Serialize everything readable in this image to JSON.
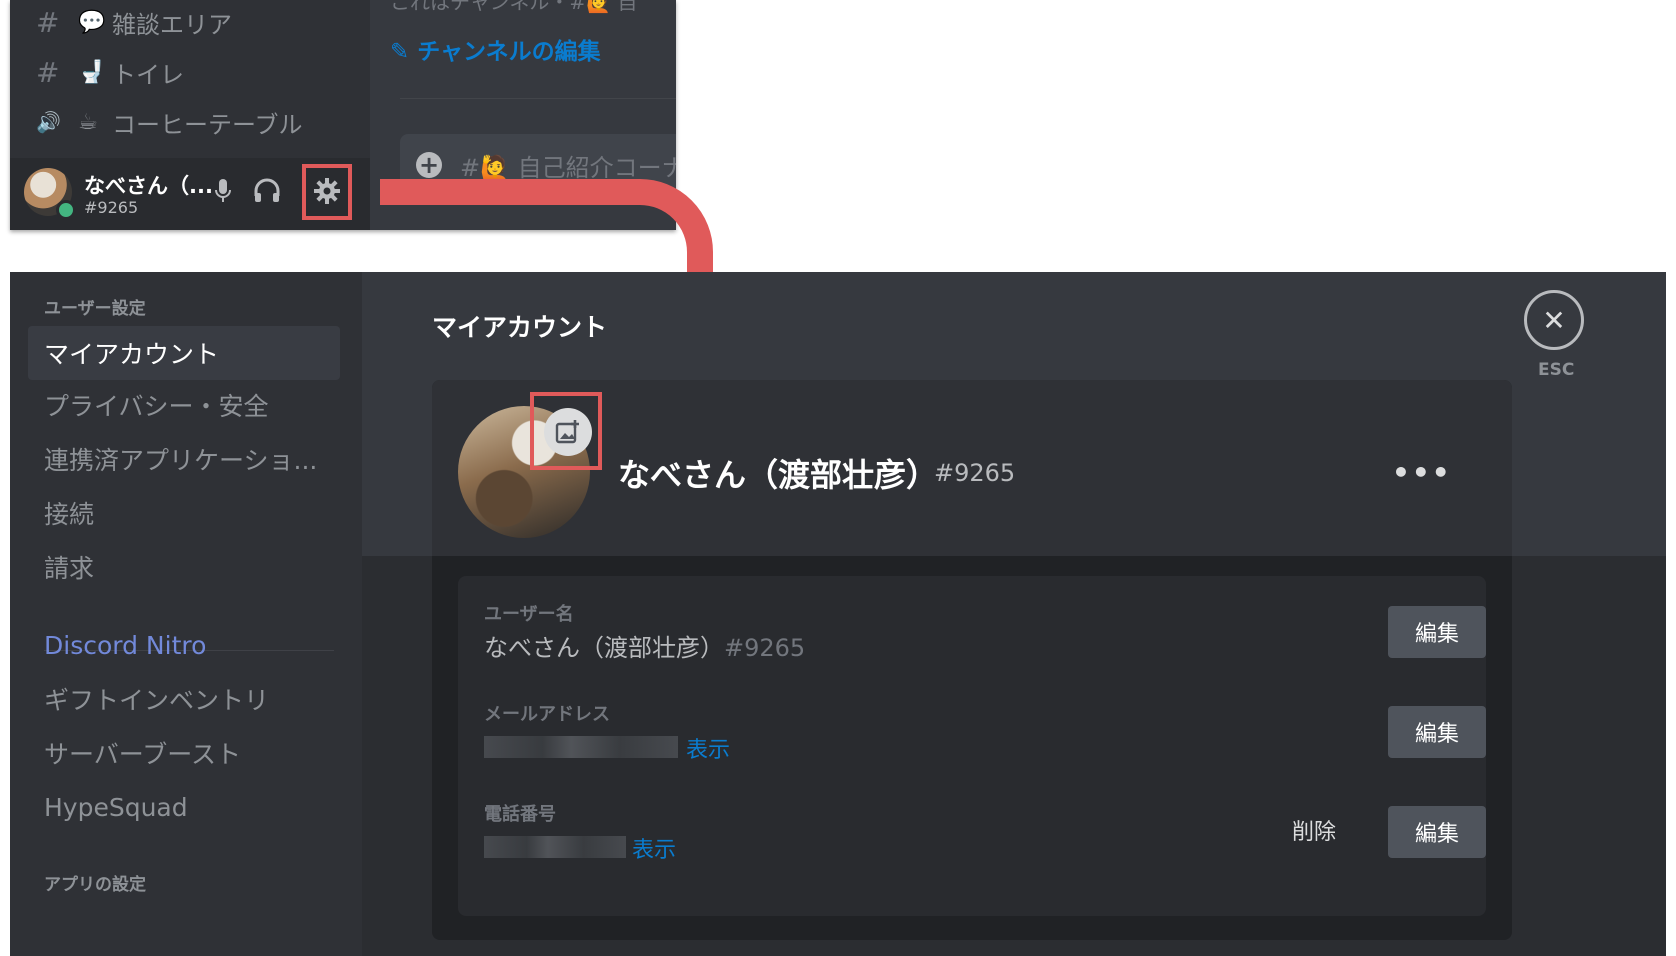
{
  "top_panel": {
    "channels": [
      {
        "prefix": "#",
        "emoji": "💬",
        "name": "雑談エリア"
      },
      {
        "prefix": "#",
        "emoji": "🚽",
        "name": "トイレ"
      },
      {
        "prefix": "🔊",
        "emoji": "☕",
        "name": "コーヒーテーブル"
      }
    ],
    "chat": {
      "top_text": "これはチャンネル・#🙋 自",
      "edit_channel_label": "✎ チャンネルの編集",
      "message_placeholder": "#🙋 自己紹介コーナー"
    },
    "user_bar": {
      "name": "なべさん（...",
      "tag": "#9265",
      "icons": [
        "microphone-icon",
        "headphones-icon",
        "gear-icon"
      ]
    }
  },
  "settings": {
    "sidebar": {
      "user_settings_header": "ユーザー設定",
      "items": [
        {
          "label": "マイアカウント",
          "active": true
        },
        {
          "label": "プライバシー・安全"
        },
        {
          "label": "連携済アプリケーショ..."
        },
        {
          "label": "接続"
        },
        {
          "label": "請求"
        }
      ],
      "nitro_label": "Discord Nitro",
      "more_items": [
        {
          "label": "ギフトインベントリ"
        },
        {
          "label": "サーバーブースト"
        },
        {
          "label": "HypeSquad"
        }
      ],
      "app_settings_header": "アプリの設定"
    },
    "page_title": "マイアカウント",
    "profile": {
      "display_name": "なべさん（渡部壮彦）",
      "tag": "#9265",
      "more_label": "•••"
    },
    "fields": [
      {
        "label": "ユーザー名",
        "value": "なべさん（渡部壮彦）",
        "tag": "#9265",
        "edit_label": "編集"
      },
      {
        "label": "メールアドレス",
        "show_label": "表示",
        "edit_label": "編集"
      },
      {
        "label": "電話番号",
        "show_label": "表示",
        "delete_label": "削除",
        "edit_label": "編集"
      }
    ],
    "close": {
      "icon": "close-icon",
      "esc_label": "ESC"
    }
  },
  "colors": {
    "highlight": "#e05a5a",
    "link": "#0a7ccf",
    "nitro": "#7289da",
    "online": "#43b581"
  }
}
